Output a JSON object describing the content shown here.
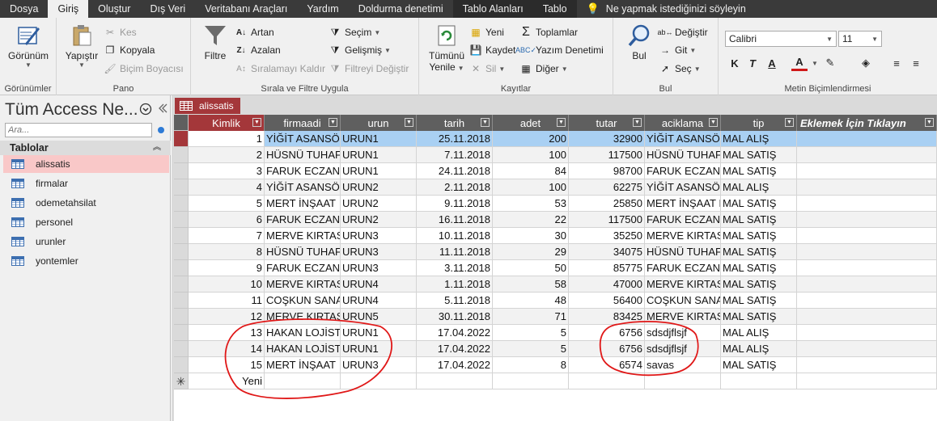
{
  "ribbon_tabs": [
    "Dosya",
    "Giriş",
    "Oluştur",
    "Dış Veri",
    "Veritabanı Araçları",
    "Yardım",
    "Doldurma denetimi",
    "Tablo Alanları",
    "Tablo"
  ],
  "ribbon_tabs_active": "Giriş",
  "tell_me": "Ne yapmak istediğinizi söyleyin",
  "groups": {
    "views": {
      "label": "Görünümler",
      "view": "Görünüm"
    },
    "clipboard": {
      "label": "Pano",
      "paste": "Yapıştır",
      "cut": "Kes",
      "copy": "Kopyala",
      "painter": "Biçim Boyacısı"
    },
    "sort": {
      "label": "Sırala ve Filtre Uygula",
      "filter": "Filtre",
      "asc": "Artan",
      "desc": "Azalan",
      "remove_sort": "Sıralamayı Kaldır",
      "selection": "Seçim",
      "advanced": "Gelişmiş",
      "toggle_filter": "Filtreyi Değiştir"
    },
    "records": {
      "label": "Kayıtlar",
      "refresh_line1": "Tümünü",
      "refresh_line2": "Yenile",
      "new": "Yeni",
      "save": "Kaydet",
      "delete": "Sil",
      "totals": "Toplamlar",
      "spelling": "Yazım Denetimi",
      "more": "Diğer"
    },
    "find": {
      "label": "Bul",
      "find": "Bul",
      "replace": "Değiştir",
      "goto": "Git",
      "select": "Seç"
    },
    "format": {
      "label": "Metin Biçimlendirmesi",
      "font": "Calibri",
      "size": "11",
      "bold": "K",
      "italic": "T",
      "underline": "A",
      "font_color": "A"
    }
  },
  "nav": {
    "title": "Tüm Access Ne...",
    "search_placeholder": "Ara...",
    "section": "Tablolar",
    "items": [
      "alissatis",
      "firmalar",
      "odemetahsilat",
      "personel",
      "urunler",
      "yontemler"
    ],
    "selected": "alissatis"
  },
  "document_tab": "alissatis",
  "table": {
    "columns": [
      "Kimlik",
      "firmaadi",
      "urun",
      "tarih",
      "adet",
      "tutar",
      "aciklama",
      "tip"
    ],
    "add_column": "Eklemek İçin Tıklayın",
    "rows": [
      [
        "1",
        "YİĞİT ASANSÖI",
        "URUN1",
        "25.11.2018",
        "200",
        "32900",
        "YİĞİT ASANSÖI",
        "MAL ALIŞ"
      ],
      [
        "2",
        "HÜSNÜ TUHAF",
        "URUN1",
        "7.11.2018",
        "100",
        "117500",
        "HÜSNÜ TUHAF",
        "MAL SATIŞ"
      ],
      [
        "3",
        "FARUK ECZANE",
        "URUN1",
        "24.11.2018",
        "84",
        "98700",
        "FARUK ECZANE",
        "MAL SATIŞ"
      ],
      [
        "4",
        "YİĞİT ASANSÖI",
        "URUN2",
        "2.11.2018",
        "100",
        "62275",
        "YİĞİT ASANSÖI",
        "MAL ALIŞ"
      ],
      [
        "5",
        "MERT İNŞAAT",
        "URUN2",
        "9.11.2018",
        "53",
        "25850",
        "MERT İNŞAAT I",
        "MAL SATIŞ"
      ],
      [
        "6",
        "FARUK ECZANE",
        "URUN2",
        "16.11.2018",
        "22",
        "117500",
        "FARUK ECZANE",
        "MAL SATIŞ"
      ],
      [
        "7",
        "MERVE KIRTAS",
        "URUN3",
        "10.11.2018",
        "30",
        "35250",
        "MERVE KIRTAS",
        "MAL SATIŞ"
      ],
      [
        "8",
        "HÜSNÜ TUHAF",
        "URUN3",
        "11.11.2018",
        "29",
        "34075",
        "HÜSNÜ TUHAF",
        "MAL SATIŞ"
      ],
      [
        "9",
        "FARUK ECZANE",
        "URUN3",
        "3.11.2018",
        "50",
        "85775",
        "FARUK ECZANE",
        "MAL SATIŞ"
      ],
      [
        "10",
        "MERVE KIRTAS",
        "URUN4",
        "1.11.2018",
        "58",
        "47000",
        "MERVE KIRTAS",
        "MAL SATIŞ"
      ],
      [
        "11",
        "COŞKUN SANA",
        "URUN4",
        "5.11.2018",
        "48",
        "56400",
        "COŞKUN SANA",
        "MAL SATIŞ"
      ],
      [
        "12",
        "MERVE KIRTAS",
        "URUN5",
        "30.11.2018",
        "71",
        "83425",
        "MERVE KIRTAS",
        "MAL SATIŞ"
      ],
      [
        "13",
        "HAKAN LOJİSTİ",
        "URUN1",
        "17.04.2022",
        "5",
        "6756",
        "sdsdjflsjf",
        "MAL ALIŞ"
      ],
      [
        "14",
        "HAKAN LOJİSTİ",
        "URUN1",
        "17.04.2022",
        "5",
        "6756",
        "sdsdjflsjf",
        "MAL ALIŞ"
      ],
      [
        "15",
        "MERT İNŞAAT",
        "URUN3",
        "17.04.2022",
        "8",
        "6574",
        "savas",
        "MAL SATIŞ"
      ]
    ],
    "new_row_label": "Yeni",
    "new_row_marker": "✳"
  },
  "colors": {
    "accent": "#a4373a",
    "row_selected": "#a9d0f3",
    "annotation": "#e01818"
  }
}
